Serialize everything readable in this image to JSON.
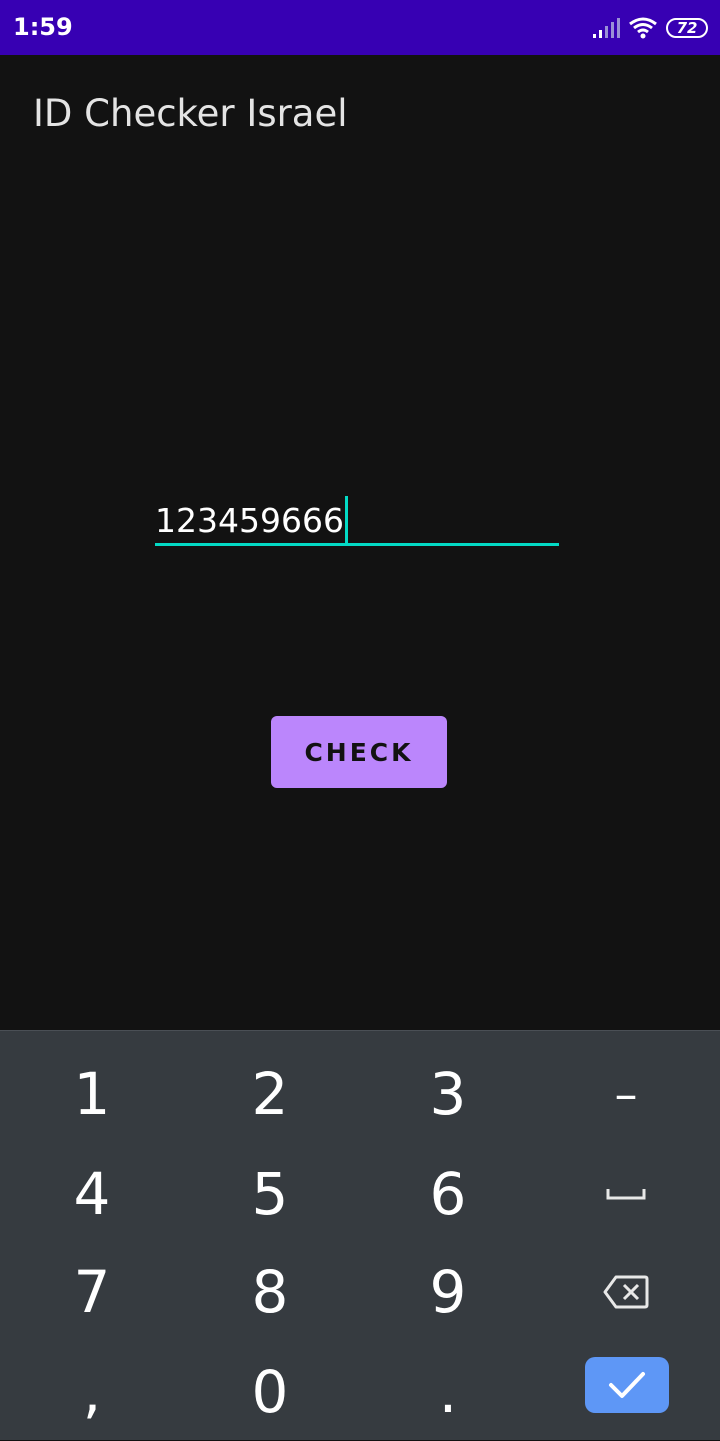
{
  "status_bar": {
    "time": "1:59",
    "battery_level": "72",
    "background": "#3700b3"
  },
  "app": {
    "title": "ID Checker Israel"
  },
  "id_input": {
    "value": "123459666",
    "accent_color": "#03dac5"
  },
  "check_button": {
    "label": "CHECK",
    "color": "#bb86fc"
  },
  "keyboard": {
    "keys": {
      "k1": "1",
      "k2": "2",
      "k3": "3",
      "minus": "–",
      "k4": "4",
      "k5": "5",
      "k6": "6",
      "k7": "7",
      "k8": "8",
      "k9": "9",
      "comma": ",",
      "k0": "0",
      "period": "."
    },
    "icons": [
      "space-icon",
      "backspace-icon",
      "checkmark-icon"
    ],
    "done_color": "#5e97f6"
  }
}
